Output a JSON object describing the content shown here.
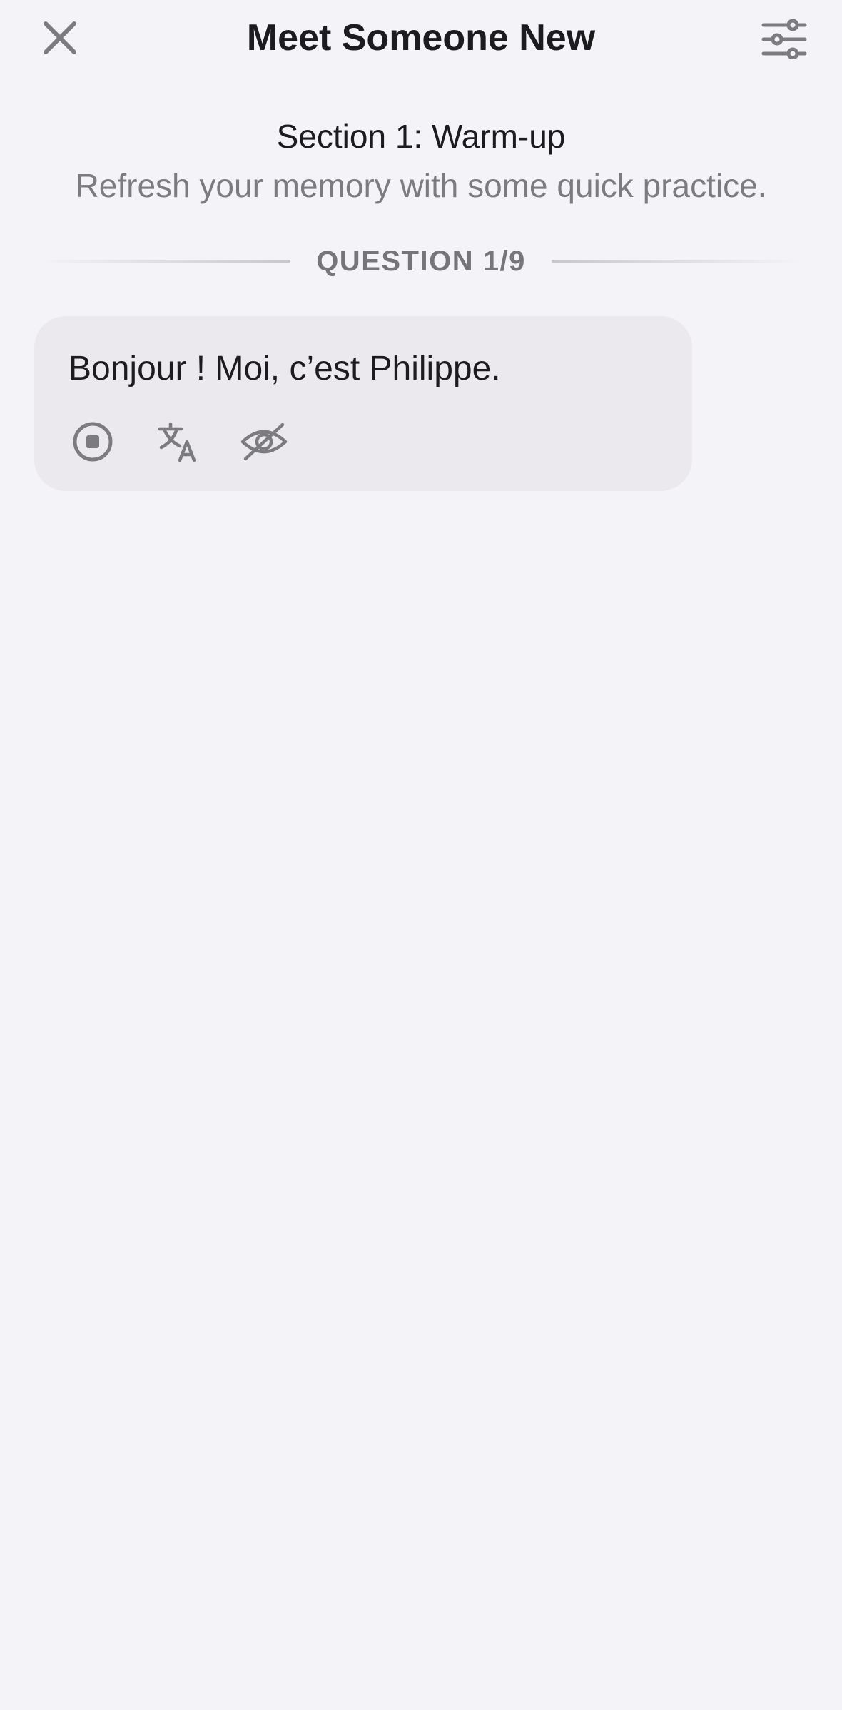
{
  "header": {
    "title": "Meet Someone New"
  },
  "section": {
    "title": "Section 1: Warm-up",
    "subtitle": "Refresh your memory with some quick practice."
  },
  "progress": {
    "label": "QUESTION 1/9",
    "current": 1,
    "total": 9
  },
  "message": {
    "text": "Bonjour ! Moi, c’est Philippe.",
    "actions": [
      "stop-icon",
      "translate-icon",
      "eye-slash-icon"
    ]
  },
  "icons": {
    "close": "close-icon",
    "settings": "sliders-icon"
  },
  "colors": {
    "background": "#f4f3f7",
    "bubble": "#ebe9ed",
    "icon": "#7c7c80",
    "text": "#1c1c1e",
    "muted": "#7c7c80"
  }
}
